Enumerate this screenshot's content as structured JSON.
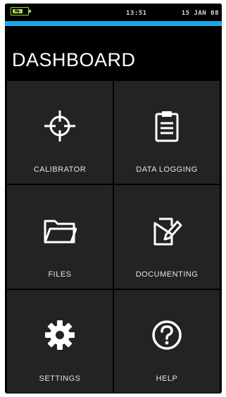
{
  "status": {
    "battery_level": 0.7,
    "battery_color": "#9fd64a",
    "charging_icon": "plug-icon",
    "time": "13:51",
    "date": "15 JAN 08"
  },
  "accent_color": "#1ea6e8",
  "page": {
    "title": "DASHBOARD"
  },
  "tiles": [
    {
      "label": "CALIBRATOR",
      "icon": "crosshair-icon"
    },
    {
      "label": "DATA LOGGING",
      "icon": "clipboard-icon"
    },
    {
      "label": "FILES",
      "icon": "folder-icon"
    },
    {
      "label": "DOCUMENTING",
      "icon": "document-pen-icon"
    },
    {
      "label": "SETTINGS",
      "icon": "gear-icon"
    },
    {
      "label": "HELP",
      "icon": "help-icon"
    }
  ]
}
